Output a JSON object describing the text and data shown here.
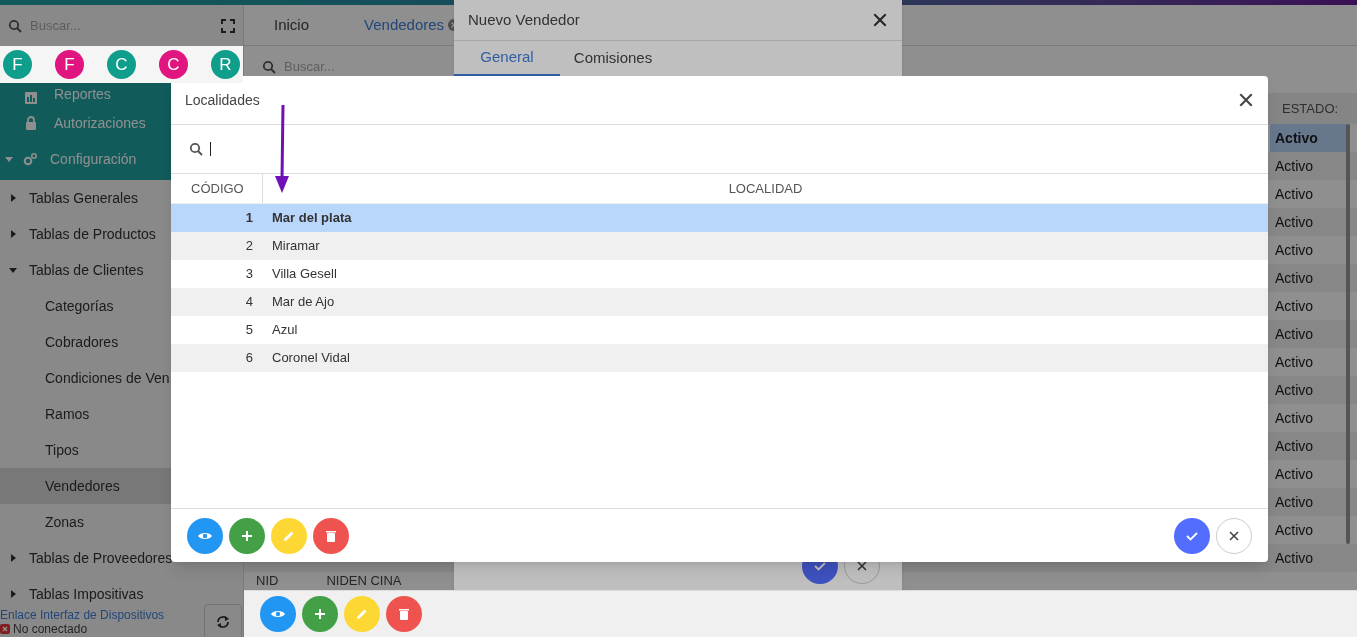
{
  "sidebar": {
    "search_placeholder": "Buscar...",
    "avatars": [
      {
        "letter": "F",
        "color": "#0f9d8c"
      },
      {
        "letter": "F",
        "color": "#e0157f"
      },
      {
        "letter": "C",
        "color": "#0f9d8c"
      },
      {
        "letter": "C",
        "color": "#e0157f"
      },
      {
        "letter": "R",
        "color": "#0f9d8c"
      }
    ],
    "sections": [
      {
        "label": "Reportes",
        "kind": "chart"
      },
      {
        "label": "Autorizaciones",
        "kind": "lock"
      },
      {
        "label": "Configuración",
        "kind": "gears",
        "expanded": true
      }
    ],
    "tree": [
      {
        "label": "Tablas Generales",
        "expanded": false
      },
      {
        "label": "Tablas de Productos",
        "expanded": false
      },
      {
        "label": "Tablas de Clientes",
        "expanded": true,
        "children": [
          {
            "label": "Categorías",
            "selected": false
          },
          {
            "label": "Cobradores",
            "selected": false
          },
          {
            "label": "Condiciones de Ven",
            "selected": false
          },
          {
            "label": "Ramos",
            "selected": false
          },
          {
            "label": "Tipos",
            "selected": false
          },
          {
            "label": "Vendedores",
            "selected": true
          },
          {
            "label": "Zonas",
            "selected": false
          }
        ]
      },
      {
        "label": "Tablas de Proveedores",
        "expanded": false
      },
      {
        "label": "Tablas Impositivas",
        "expanded": false
      }
    ],
    "device_link": "Enlace Interfaz de Dispositivos",
    "connection": "No conectado"
  },
  "main": {
    "tabs": [
      {
        "label": "Inicio",
        "selected": false,
        "closable": false
      },
      {
        "label": "Vendedores",
        "selected": true,
        "closable": true
      }
    ],
    "search_placeholder": "Buscar...",
    "table": {
      "columns": [
        "ESTADO:"
      ],
      "rows": [
        {
          "estado": "Activo",
          "selected": true
        },
        {
          "estado": "Activo",
          "selected": false
        },
        {
          "estado": "Activo",
          "selected": false
        },
        {
          "estado": "Activo",
          "selected": false
        },
        {
          "estado": "Activo",
          "selected": false
        },
        {
          "estado": "Activo",
          "selected": false
        },
        {
          "estado": "Activo",
          "selected": false
        },
        {
          "estado": "Activo",
          "selected": false
        },
        {
          "estado": "Activo",
          "selected": false
        },
        {
          "estado": "Activo",
          "selected": false
        },
        {
          "estado": "Activo",
          "selected": false
        },
        {
          "estado": "Activo",
          "selected": false
        },
        {
          "estado": "Activo",
          "selected": false
        },
        {
          "estado": "Activo",
          "selected": false
        },
        {
          "estado": "Activo",
          "selected": false
        },
        {
          "estado": "Activo",
          "selected": false
        }
      ],
      "footer_labels": [
        "NID",
        "NIDEN CINA"
      ]
    }
  },
  "dialog_vendedor": {
    "title": "Nuevo Vendedor",
    "tabs": [
      {
        "label": "General",
        "selected": true
      },
      {
        "label": "Comisiones",
        "selected": false
      }
    ]
  },
  "dialog_localidades": {
    "title": "Localidades",
    "columns": [
      "CÓDIGO",
      "LOCALIDAD"
    ],
    "rows": [
      {
        "codigo": "1",
        "localidad": "Mar del plata",
        "selected": true
      },
      {
        "codigo": "2",
        "localidad": "Miramar",
        "selected": false
      },
      {
        "codigo": "3",
        "localidad": "Villa Gesell",
        "selected": false
      },
      {
        "codigo": "4",
        "localidad": "Mar de Ajo",
        "selected": false
      },
      {
        "codigo": "5",
        "localidad": "Azul",
        "selected": false
      },
      {
        "codigo": "6",
        "localidad": "Coronel Vidal",
        "selected": false
      }
    ]
  }
}
